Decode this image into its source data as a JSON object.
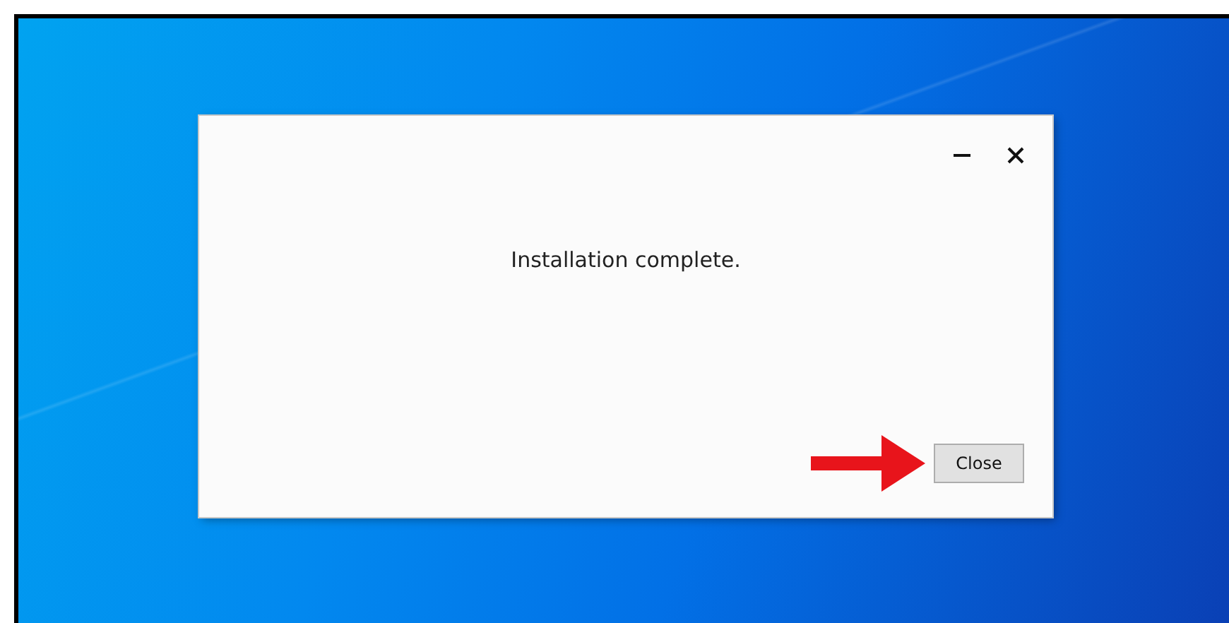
{
  "dialog": {
    "message": "Installation complete.",
    "button": "Close"
  }
}
